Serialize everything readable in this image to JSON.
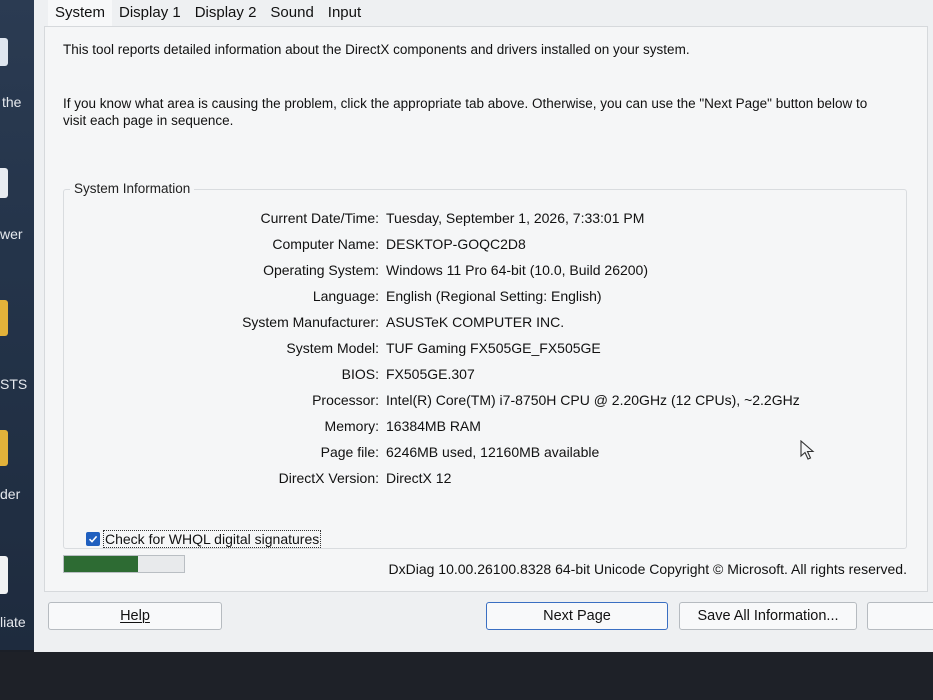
{
  "left_window": {
    "snippets": [
      "the",
      "wer",
      "STS",
      "der",
      "liate"
    ]
  },
  "tabs": [
    "System",
    "Display 1",
    "Display 2",
    "Sound",
    "Input"
  ],
  "intro": {
    "line1": "This tool reports detailed information about the DirectX components and drivers installed on your system.",
    "line2": "If you know what area is causing the problem, click the appropriate tab above.  Otherwise, you can use the \"Next Page\" button below to",
    "line3": "visit each page in sequence."
  },
  "system_info": {
    "title": "System Information",
    "rows": [
      {
        "label": "Current Date/Time:",
        "value": "Tuesday, September 1, 2026, 7:33:01 PM"
      },
      {
        "label": "Computer Name:",
        "value": "DESKTOP-GOQC2D8"
      },
      {
        "label": "Operating System:",
        "value": "Windows 11 Pro 64-bit (10.0, Build 26200)"
      },
      {
        "label": "Language:",
        "value": "English (Regional Setting: English)"
      },
      {
        "label": "System Manufacturer:",
        "value": "ASUSTeK COMPUTER INC."
      },
      {
        "label": "System Model:",
        "value": "TUF Gaming FX505GE_FX505GE"
      },
      {
        "label": "BIOS:",
        "value": "FX505GE.307"
      },
      {
        "label": "Processor:",
        "value": "Intel(R) Core(TM) i7-8750H CPU @ 2.20GHz (12 CPUs), ~2.2GHz"
      },
      {
        "label": "Memory:",
        "value": "16384MB RAM"
      },
      {
        "label": "Page file:",
        "value": "6246MB used, 12160MB available"
      },
      {
        "label": "DirectX Version:",
        "value": "DirectX 12"
      }
    ],
    "whql_label": "Check for WHQL digital signatures",
    "whql_checked": true
  },
  "progress": {
    "fraction": 0.62,
    "color": "#2d6b33"
  },
  "footer": {
    "copyright": "DxDiag 10.00.26100.8328 64-bit Unicode  Copyright © Microsoft. All rights reserved."
  },
  "buttons": {
    "help": "Help",
    "next_page": "Next Page",
    "save_all": "Save All Information..."
  },
  "colors": {
    "accent": "#1f5fbf",
    "default_button_border": "#3a6fc2"
  }
}
